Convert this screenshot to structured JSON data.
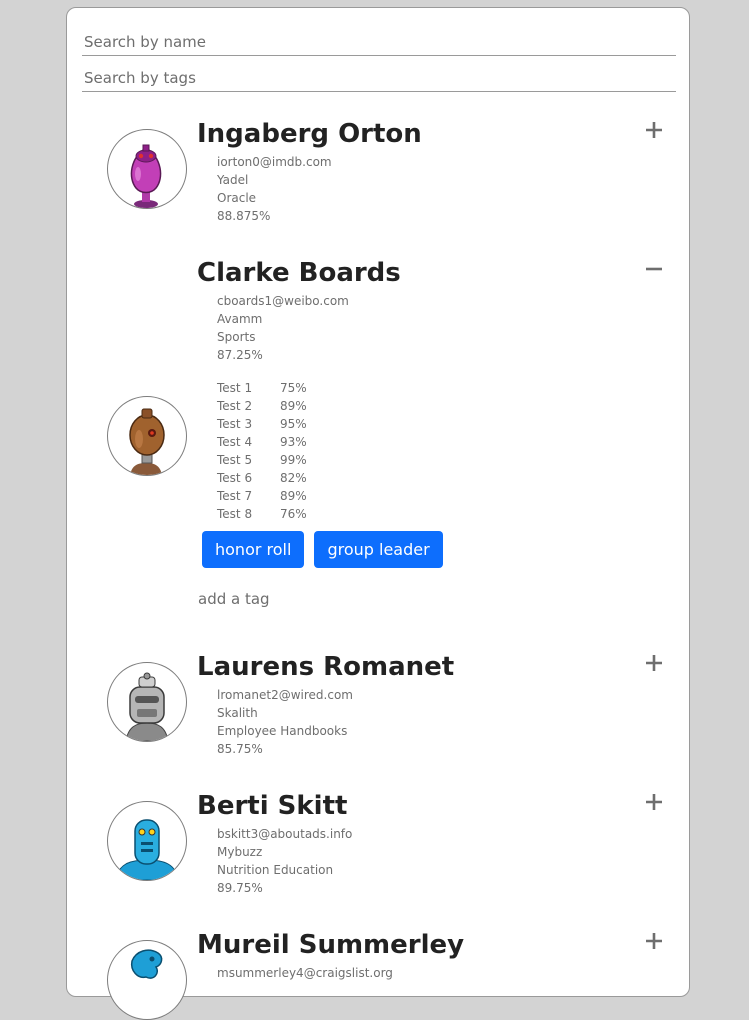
{
  "search": {
    "name_placeholder": "Search by name",
    "tags_placeholder": "Search by tags"
  },
  "students": [
    {
      "name": "Ingaberg Orton",
      "email": "iorton0@imdb.com",
      "company": "Yadel",
      "skill": "Oracle",
      "average": "88.875%",
      "expanded": false,
      "toggle_icon": "plus-icon",
      "avatar_icon": "robot-avatar-purple"
    },
    {
      "name": "Clarke Boards",
      "email": "cboards1@weibo.com",
      "company": "Avamm",
      "skill": "Sports",
      "average": "87.25%",
      "expanded": true,
      "toggle_icon": "minus-icon",
      "avatar_icon": "robot-avatar-brown",
      "tests": [
        {
          "label": "Test 1",
          "score": "75%"
        },
        {
          "label": "Test 2",
          "score": "89%"
        },
        {
          "label": "Test 3",
          "score": "95%"
        },
        {
          "label": "Test 4",
          "score": "93%"
        },
        {
          "label": "Test 5",
          "score": "99%"
        },
        {
          "label": "Test 6",
          "score": "82%"
        },
        {
          "label": "Test 7",
          "score": "89%"
        },
        {
          "label": "Test 8",
          "score": "76%"
        }
      ],
      "tags": [
        "honor roll",
        "group leader"
      ],
      "add_tag_placeholder": "add a tag"
    },
    {
      "name": "Laurens Romanet",
      "email": "lromanet2@wired.com",
      "company": "Skalith",
      "skill": "Employee Handbooks",
      "average": "85.75%",
      "expanded": false,
      "toggle_icon": "plus-icon",
      "avatar_icon": "robot-avatar-gray"
    },
    {
      "name": "Berti Skitt",
      "email": "bskitt3@aboutads.info",
      "company": "Mybuzz",
      "skill": "Nutrition Education",
      "average": "89.75%",
      "expanded": false,
      "toggle_icon": "plus-icon",
      "avatar_icon": "robot-avatar-blue"
    },
    {
      "name": "Mureil Summerley",
      "email": "msummerley4@craigslist.org",
      "expanded": false,
      "toggle_icon": "plus-icon",
      "avatar_icon": "robot-avatar-blue"
    }
  ],
  "colors": {
    "page_background": "#d3d3d3",
    "card_background": "#ffffff",
    "tag_background": "#0d6efd",
    "tag_text": "#ffffff",
    "muted_text": "#6e6e6e"
  }
}
